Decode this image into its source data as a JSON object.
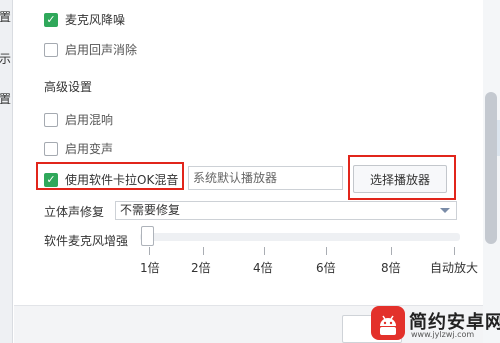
{
  "sidebar": {
    "items": [
      {
        "label": "置"
      },
      {
        "label": "示"
      },
      {
        "label": "置"
      }
    ]
  },
  "options": {
    "noise_reduction": {
      "label": "麦克风降噪",
      "checked": true
    },
    "echo_cancel": {
      "label": "启用回声消除",
      "checked": false
    }
  },
  "advanced": {
    "title": "高级设置",
    "reverb": {
      "label": "启用混响",
      "checked": false
    },
    "voice_change": {
      "label": "启用变声",
      "checked": false
    },
    "karaoke_mix": {
      "label": "使用软件卡拉OK混音",
      "checked": true
    },
    "player_field_value": "系统默认播放器",
    "select_player_label": "选择播放器"
  },
  "stereo": {
    "label": "立体声修复",
    "selected": "不需要修复"
  },
  "mic_boost": {
    "label": "软件麦克风增强",
    "value_index": 0,
    "ticks": [
      "1倍",
      "2倍",
      "4倍",
      "6倍",
      "8倍",
      "自动放大"
    ]
  },
  "watermark": {
    "title": "简约安卓网",
    "url": "www.jylzwj.com"
  },
  "colors": {
    "check_green": "#2fa85a",
    "highlight_red": "#e1251b",
    "logo_red": "#e3312b"
  },
  "icons": {
    "check": "check-icon",
    "dropdown": "chevron-down-icon"
  }
}
